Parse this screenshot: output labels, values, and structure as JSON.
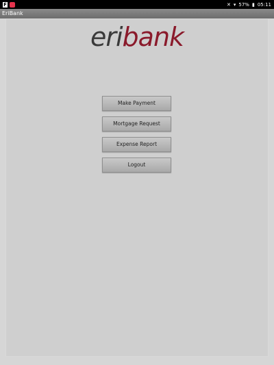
{
  "status_bar": {
    "notif_letter": "F",
    "battery": "57%",
    "time": "05:11"
  },
  "app": {
    "title": "EriBank"
  },
  "logo": {
    "part1": "eri",
    "part2": "bank",
    "colors": {
      "part1": "#3a3a3a",
      "part2": "#8a1a2b"
    }
  },
  "menu": {
    "make_payment": "Make Payment",
    "mortgage_request": "Mortgage Request",
    "expense_report": "Expense Report",
    "logout": "Logout"
  }
}
